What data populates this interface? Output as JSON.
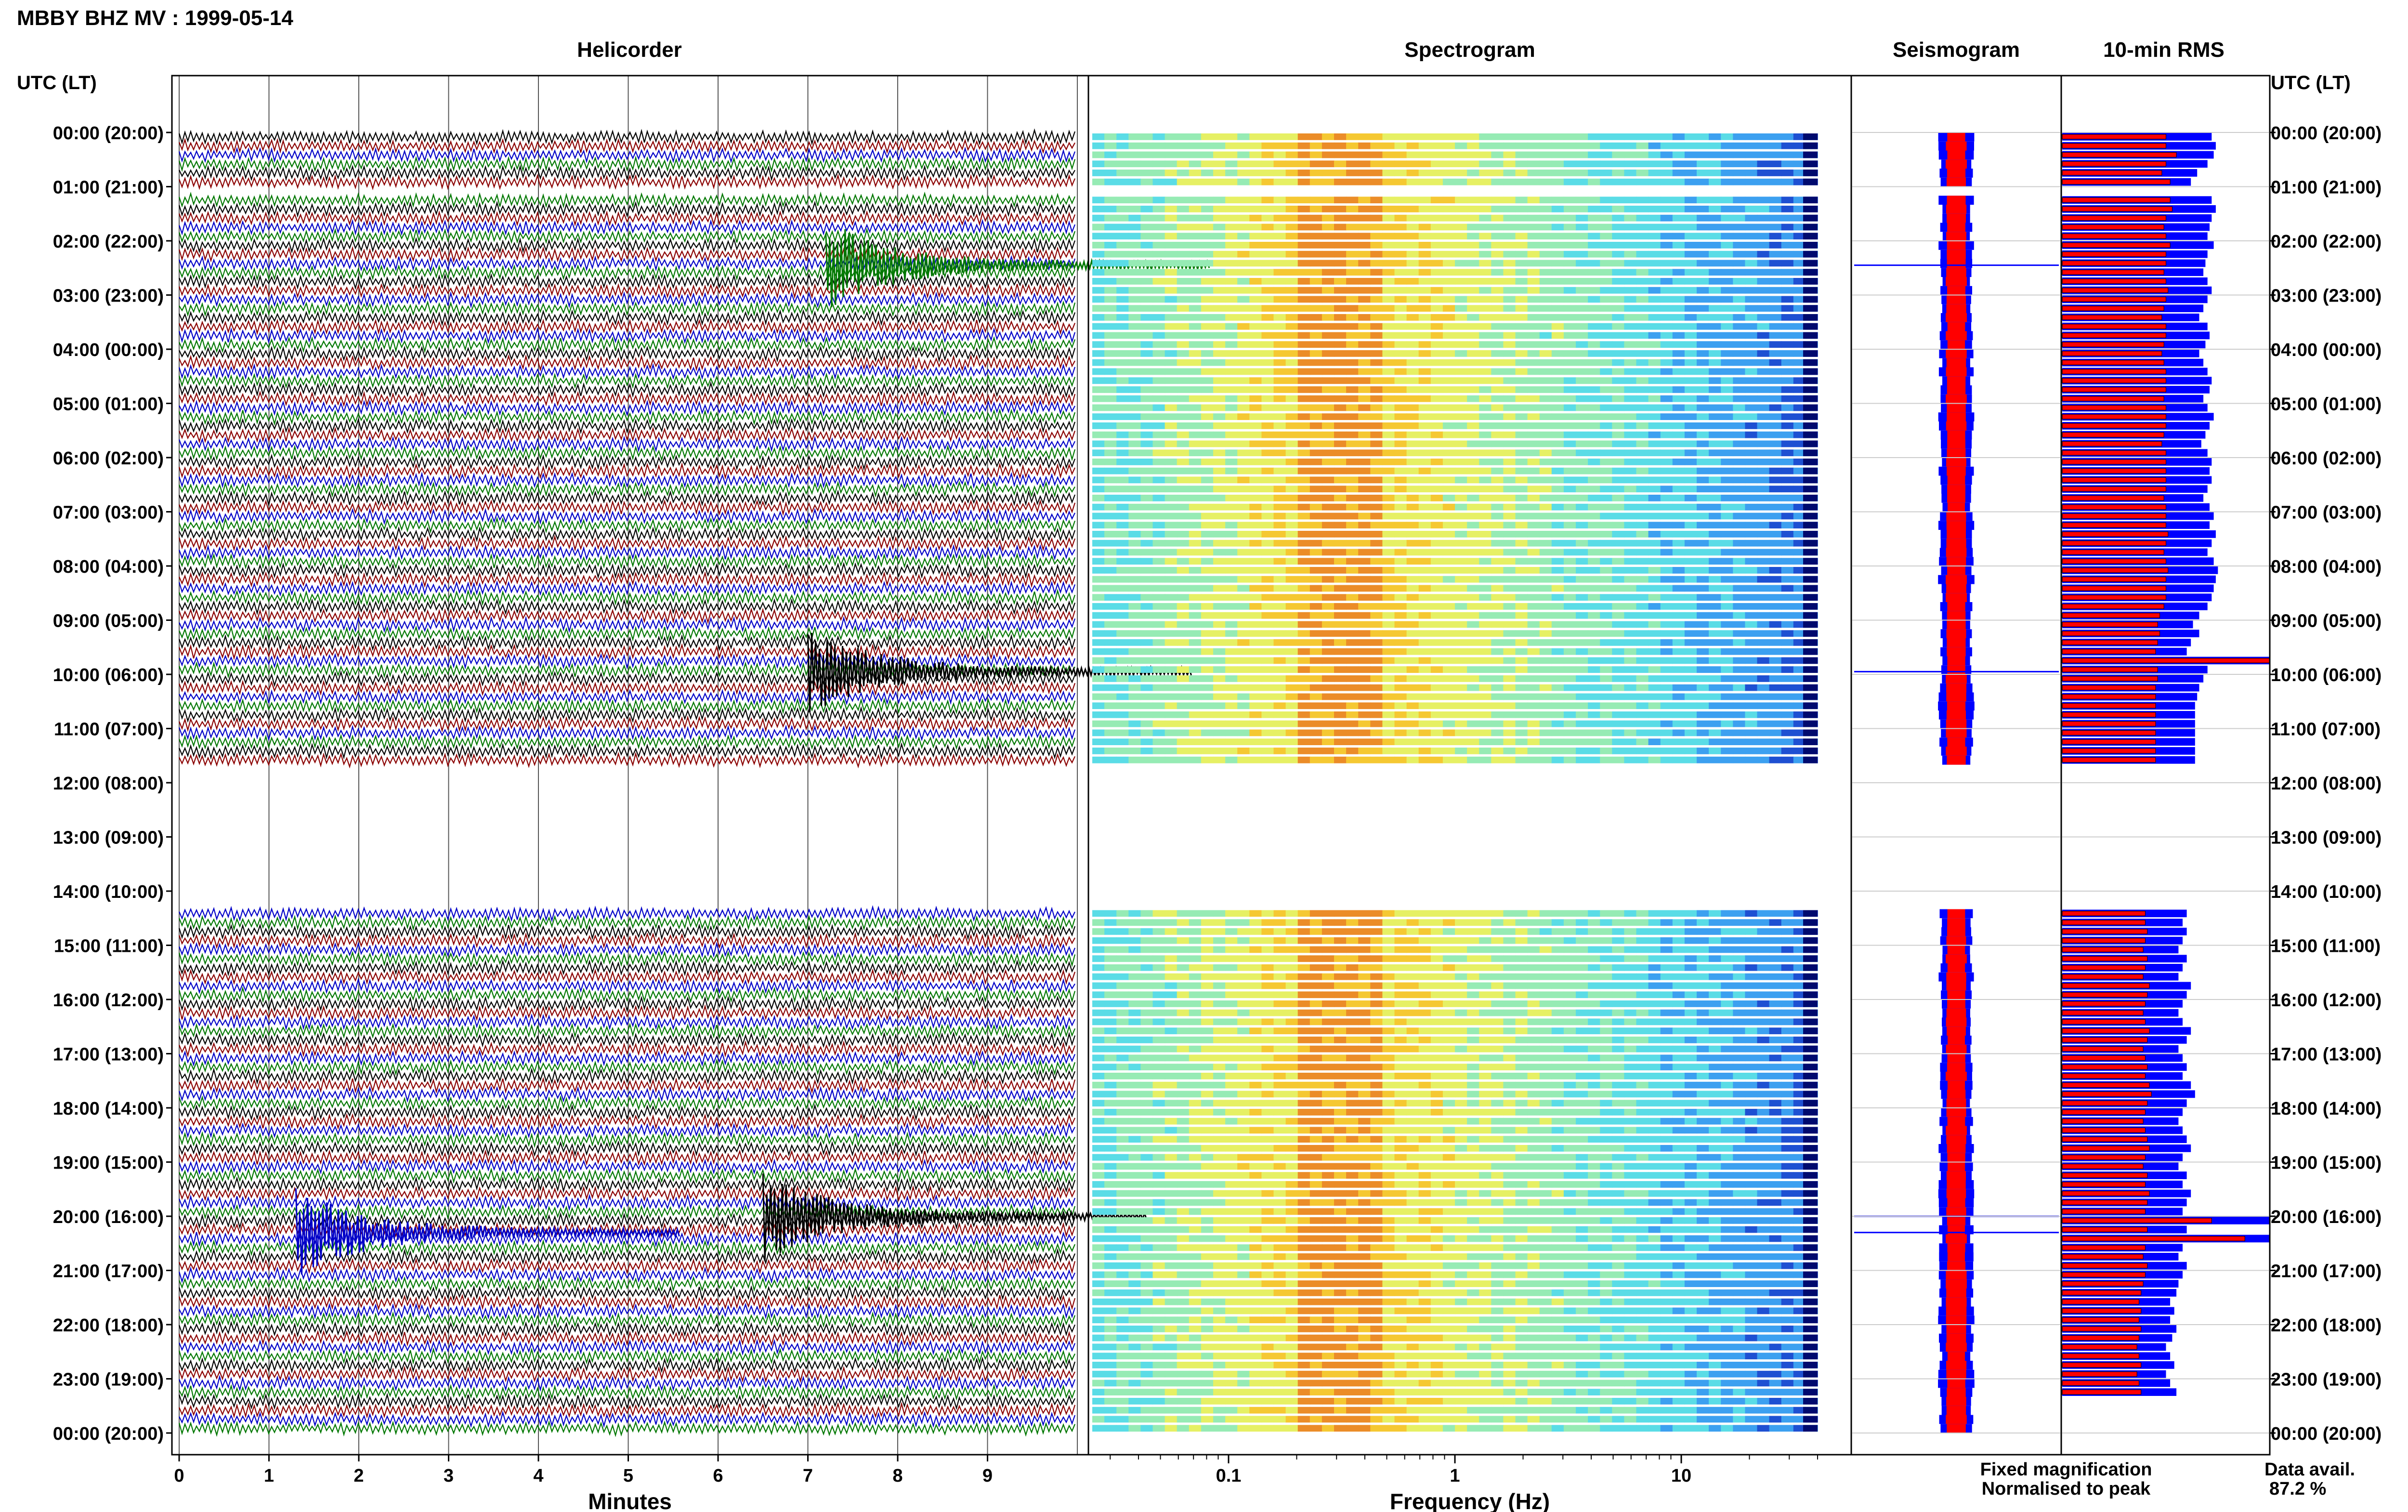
{
  "page": {
    "title": "MBBY BHZ MV : 1999-05-14",
    "utc_header_left": "UTC (LT)",
    "utc_header_right": "UTC (LT)"
  },
  "panels": {
    "helicorder": "Helicorder",
    "spectrogram": "Spectrogram",
    "seismogram": "Seismogram",
    "rms": "10-min RMS"
  },
  "axes": {
    "helicorder_xlabel": "Minutes",
    "helicorder_ticks": [
      "0",
      "1",
      "2",
      "3",
      "4",
      "5",
      "6",
      "7",
      "8",
      "9"
    ],
    "spectrogram_xlabel": "Frequency (Hz)",
    "spectrogram_ticks": [
      "0.1",
      "1",
      "10"
    ],
    "time_labels": [
      "00:00 (20:00)",
      "01:00 (21:00)",
      "02:00 (22:00)",
      "03:00 (23:00)",
      "04:00 (00:00)",
      "05:00 (01:00)",
      "06:00 (02:00)",
      "07:00 (03:00)",
      "08:00 (04:00)",
      "09:00 (05:00)",
      "10:00 (06:00)",
      "11:00 (07:00)",
      "12:00 (08:00)",
      "13:00 (09:00)",
      "14:00 (10:00)",
      "15:00 (11:00)",
      "16:00 (12:00)",
      "17:00 (13:00)",
      "18:00 (14:00)",
      "19:00 (15:00)",
      "20:00 (16:00)",
      "21:00 (17:00)",
      "22:00 (18:00)",
      "23:00 (19:00)",
      "00:00 (20:00)"
    ]
  },
  "legend": {
    "fixed": "Fixed magnification",
    "normalised": "Normalised to peak",
    "fixed_color": "#0000ff",
    "normalised_color": "#ff0000"
  },
  "availability": {
    "label": "Data avail.",
    "value": "87.2 %"
  },
  "chart_data": {
    "type": "heatmap",
    "station": "MBBY BHZ MV",
    "date": "1999-05-14",
    "hours": 24,
    "data_gaps": [
      [
        0.92,
        1.12
      ],
      [
        11.6,
        14.25
      ]
    ],
    "helicorder": {
      "xlim": [
        0,
        10
      ],
      "trace_colors": [
        "#000000",
        "#8b0000",
        "#0000c8",
        "#007800"
      ],
      "events": [
        {
          "hour": 9.95,
          "minute": 7.0,
          "color": "#000000"
        },
        {
          "hour": 20.3,
          "minute": 1.3,
          "color": "#0000c8"
        },
        {
          "hour": 20.0,
          "minute": 6.5,
          "color": "#000000"
        },
        {
          "hour": 2.45,
          "minute": 7.2,
          "color": "#007800"
        }
      ]
    },
    "spectrogram": {
      "scale": "log",
      "xlim": [
        0.025,
        40
      ],
      "peak_band_hz": [
        0.2,
        0.5
      ],
      "colormap": [
        "#0a1e8c",
        "#1e50d2",
        "#3ca0f0",
        "#5adce6",
        "#96ebb4",
        "#e6f064",
        "#f5c832",
        "#eb8c28"
      ]
    },
    "rms_10min": {
      "units": "relative",
      "fixed_magnification": [
        0.72,
        0.74,
        0.73,
        0.7,
        0.65,
        0.62,
        0.7,
        0.72,
        0.74,
        0.72,
        0.71,
        0.7,
        0.73,
        0.7,
        0.69,
        0.68,
        0.7,
        0.72,
        0.7,
        0.68,
        0.66,
        0.7,
        0.71,
        0.69,
        0.66,
        0.68,
        0.7,
        0.72,
        0.71,
        0.68,
        0.7,
        0.73,
        0.71,
        0.69,
        0.67,
        0.7,
        0.72,
        0.71,
        0.72,
        0.7,
        0.68,
        0.71,
        0.73,
        0.71,
        0.74,
        0.72,
        0.7,
        0.73,
        0.75,
        0.74,
        0.73,
        0.72,
        0.7,
        0.66,
        0.63,
        0.66,
        0.62,
        0.6,
        1.0,
        0.7,
        0.68,
        0.66,
        0.65,
        0.64,
        0.64,
        0.64,
        0.64,
        0.64,
        0.64,
        0.64,
        0.64,
        0.64,
        0.64,
        0.64,
        0.64,
        0.64,
        0.64,
        0.64,
        0.64,
        0.64,
        0.64,
        0.64,
        0.64,
        0.64,
        0.64,
        0.76,
        0.6,
        0.58,
        0.6,
        0.58,
        0.56,
        0.6,
        0.58,
        0.56,
        0.62,
        0.6,
        0.58,
        0.56,
        0.58,
        0.62,
        0.6,
        0.56,
        0.58,
        0.6,
        0.58,
        0.62,
        0.64,
        0.6,
        0.58,
        0.56,
        0.58,
        0.6,
        0.62,
        0.58,
        0.56,
        0.6,
        0.58,
        0.62,
        0.6,
        0.58,
        1.0,
        0.6,
        1.0,
        0.58,
        0.56,
        0.6,
        0.58,
        0.56,
        0.55,
        0.52,
        0.54,
        0.52,
        0.55,
        0.53,
        0.5,
        0.52,
        0.54,
        0.5,
        0.52,
        0.55
      ],
      "normalised_to_peak": [
        0.5,
        0.5,
        0.55,
        0.5,
        0.48,
        0.52,
        0.5,
        0.52,
        0.53,
        0.5,
        0.49,
        0.5,
        0.52,
        0.5,
        0.5,
        0.49,
        0.5,
        0.51,
        0.5,
        0.49,
        0.48,
        0.5,
        0.5,
        0.49,
        0.48,
        0.49,
        0.5,
        0.5,
        0.5,
        0.49,
        0.5,
        0.5,
        0.5,
        0.49,
        0.48,
        0.5,
        0.5,
        0.5,
        0.5,
        0.5,
        0.49,
        0.5,
        0.5,
        0.5,
        0.51,
        0.5,
        0.49,
        0.5,
        0.51,
        0.5,
        0.5,
        0.5,
        0.49,
        0.47,
        0.46,
        0.47,
        0.46,
        0.45,
        1.0,
        0.46,
        0.46,
        0.45,
        0.45,
        0.45,
        0.45,
        0.45,
        0.45,
        0.45,
        0.45,
        0.45,
        0.45,
        0.45,
        0.45,
        0.45,
        0.45,
        0.45,
        0.45,
        0.45,
        0.45,
        0.45,
        0.45,
        0.45,
        0.45,
        0.45,
        0.45,
        0.52,
        0.4,
        0.4,
        0.41,
        0.4,
        0.39,
        0.41,
        0.4,
        0.39,
        0.42,
        0.41,
        0.4,
        0.39,
        0.4,
        0.42,
        0.41,
        0.39,
        0.4,
        0.41,
        0.4,
        0.42,
        0.43,
        0.41,
        0.4,
        0.39,
        0.4,
        0.41,
        0.42,
        0.4,
        0.39,
        0.41,
        0.4,
        0.42,
        0.41,
        0.4,
        0.72,
        0.41,
        0.88,
        0.4,
        0.39,
        0.41,
        0.4,
        0.39,
        0.38,
        0.37,
        0.38,
        0.37,
        0.38,
        0.37,
        0.36,
        0.37,
        0.38,
        0.36,
        0.37,
        0.38
      ]
    }
  }
}
